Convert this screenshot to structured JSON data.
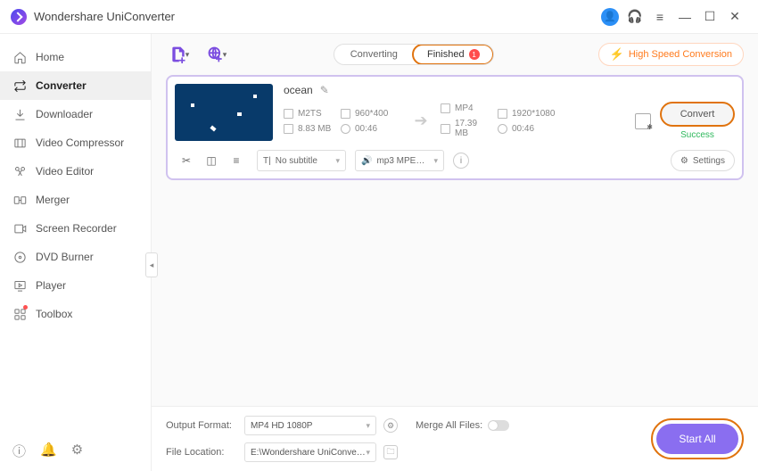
{
  "app": {
    "title": "Wondershare UniConverter"
  },
  "sidebar": {
    "items": [
      {
        "label": "Home"
      },
      {
        "label": "Converter"
      },
      {
        "label": "Downloader"
      },
      {
        "label": "Video Compressor"
      },
      {
        "label": "Video Editor"
      },
      {
        "label": "Merger"
      },
      {
        "label": "Screen Recorder"
      },
      {
        "label": "DVD Burner"
      },
      {
        "label": "Player"
      },
      {
        "label": "Toolbox"
      }
    ]
  },
  "tabs": {
    "converting": "Converting",
    "finished": "Finished",
    "finished_badge": "1"
  },
  "toolbar": {
    "high_speed": "High Speed Conversion"
  },
  "file": {
    "name": "ocean",
    "src": {
      "format": "M2TS",
      "resolution": "960*400",
      "size": "8.83 MB",
      "duration": "00:46"
    },
    "dst": {
      "format": "MP4",
      "resolution": "1920*1080",
      "size": "17.39 MB",
      "duration": "00:46"
    },
    "convert_label": "Convert",
    "status": "Success",
    "subtitle": "No subtitle",
    "audio": "mp3 MPEG lay...",
    "settings_label": "Settings"
  },
  "bottom": {
    "output_format_label": "Output Format:",
    "output_format_value": "MP4 HD 1080P",
    "file_location_label": "File Location:",
    "file_location_value": "E:\\Wondershare UniConverter",
    "merge_label": "Merge All Files:",
    "start_all": "Start All"
  }
}
